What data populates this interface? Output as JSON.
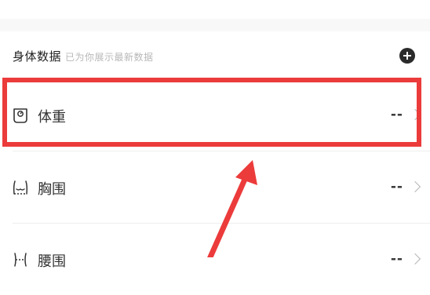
{
  "body_data": {
    "title": "身体数据",
    "subtitle": "已为你展示最新数据",
    "add_icon": "plus-circle-icon",
    "rows": [
      {
        "label": "体重",
        "value": "--",
        "icon": "scale-icon"
      },
      {
        "label": "胸围",
        "value": "--",
        "icon": "chest-icon"
      },
      {
        "label": "腰围",
        "value": "--",
        "icon": "waist-icon"
      }
    ]
  },
  "annotation": {
    "highlight_color": "#ec3b3b",
    "arrow_color": "#ec3b3b"
  }
}
